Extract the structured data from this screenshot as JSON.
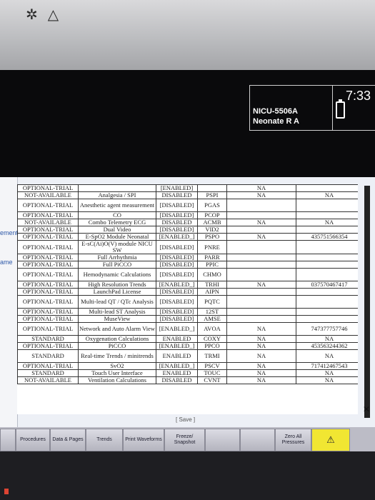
{
  "bezel": {
    "icons": [
      "sun-sparkle-icon",
      "warning-triangle-icon"
    ]
  },
  "patient": {
    "bed": "NICU-5506A",
    "name": "Neonate R A"
  },
  "status": {
    "time": "7:33",
    "battery_icon": "battery-icon"
  },
  "sidebar": {
    "labels": [
      "ement",
      "ame"
    ]
  },
  "table": {
    "rows": [
      {
        "status": "OPTIONAL-TRIAL",
        "feature": "",
        "state": "[ENABLED]",
        "code": "",
        "key": "NA",
        "lic": "",
        "type": "sh"
      },
      {
        "status": "NOT-AVAILABLE",
        "feature": "Analgesia / SPI",
        "state": "DISABLED",
        "code": "PSPI",
        "key": "NA",
        "lic": "NA",
        "type": "n"
      },
      {
        "status": "OPTIONAL-TRIAL",
        "feature": "Anesthetic agent measurement",
        "state": "[DISABLED]",
        "code": "PGAS",
        "key": "",
        "lic": "",
        "type": "t"
      },
      {
        "status": "OPTIONAL-TRIAL",
        "feature": "CO",
        "state": "[DISABLED]",
        "code": "PCOP",
        "key": "",
        "lic": "",
        "type": "n"
      },
      {
        "status": "NOT-AVAILABLE",
        "feature": "Combo Telemetry ECG",
        "state": "DISABLED",
        "code": "ACMB",
        "key": "NA",
        "lic": "NA",
        "type": "n"
      },
      {
        "status": "OPTIONAL-TRIAL",
        "feature": "Dual Video",
        "state": "[DISABLED]",
        "code": "VID2",
        "key": "",
        "lic": "",
        "type": "n"
      },
      {
        "status": "OPTIONAL-TRIAL",
        "feature": "E-SpO2 Module Neonatal",
        "state": "[ENABLED_]",
        "code": "PSPO",
        "key": "NA",
        "lic": "435751566354",
        "type": "n"
      },
      {
        "status": "OPTIONAL-TRIAL",
        "feature": "E-sC(Ai)O(V) module NICU SW",
        "state": "[DISABLED]",
        "code": "PNRE",
        "key": "",
        "lic": "",
        "type": "t"
      },
      {
        "status": "OPTIONAL-TRIAL",
        "feature": "Full Arrhythmia",
        "state": "[DISABLED]",
        "code": "PARR",
        "key": "",
        "lic": "",
        "type": "n"
      },
      {
        "status": "OPTIONAL-TRIAL",
        "feature": "Full PiCCO",
        "state": "[DISABLED]",
        "code": "PPIC",
        "key": "",
        "lic": "",
        "type": "n"
      },
      {
        "status": "OPTIONAL-TRIAL",
        "feature": "Hemodynamic Calculations",
        "state": "[DISABLED]",
        "code": "CHMO",
        "key": "",
        "lic": "",
        "type": "t"
      },
      {
        "status": "OPTIONAL-TRIAL",
        "feature": "High Resolution Trends",
        "state": "[ENABLED_]",
        "code": "TRHI",
        "key": "NA",
        "lic": "037570467417",
        "type": "n"
      },
      {
        "status": "OPTIONAL-TRIAL",
        "feature": "LaunchPad License",
        "state": "[DISABLED]",
        "code": "AIPN",
        "key": "",
        "lic": "",
        "type": "n"
      },
      {
        "status": "OPTIONAL-TRIAL",
        "feature": "Multi-lead QT / QTc Analysis",
        "state": "[DISABLED]",
        "code": "PQTC",
        "key": "",
        "lic": "",
        "type": "t"
      },
      {
        "status": "OPTIONAL-TRIAL",
        "feature": "Multi-lead ST Analysis",
        "state": "[DISABLED]",
        "code": "12ST",
        "key": "",
        "lic": "",
        "type": "n"
      },
      {
        "status": "OPTIONAL-TRIAL",
        "feature": "MuseView",
        "state": "[DISABLED]",
        "code": "AMSE",
        "key": "",
        "lic": "",
        "type": "n"
      },
      {
        "status": "OPTIONAL-TRIAL",
        "feature": "Network and Auto Alarm View",
        "state": "[ENABLED_]",
        "code": "AVOA",
        "key": "NA",
        "lic": "747377757746",
        "type": "t"
      },
      {
        "status": "STANDARD",
        "feature": "Oxygenation Calculations",
        "state": "ENABLED",
        "code": "COXY",
        "key": "NA",
        "lic": "NA",
        "type": "n"
      },
      {
        "status": "OPTIONAL-TRIAL",
        "feature": "PiCCO",
        "state": "[ENABLED_]",
        "code": "PPCO",
        "key": "NA",
        "lic": "453563244362",
        "type": "n"
      },
      {
        "status": "STANDARD",
        "feature": "Real-time Trends / minitrends",
        "state": "ENABLED",
        "code": "TRMI",
        "key": "NA",
        "lic": "NA",
        "type": "t"
      },
      {
        "status": "OPTIONAL-TRIAL",
        "feature": "SvO2",
        "state": "[ENABLED_]",
        "code": "PSCV",
        "key": "NA",
        "lic": "717412467543",
        "type": "n"
      },
      {
        "status": "STANDARD",
        "feature": "Touch User Interface",
        "state": "ENABLED",
        "code": "TOUC",
        "key": "NA",
        "lic": "NA",
        "type": "n"
      },
      {
        "status": "NOT-AVAILABLE",
        "feature": "Ventilation Calculations",
        "state": "DISABLED",
        "code": "CVNT",
        "key": "NA",
        "lic": "NA",
        "type": "n"
      }
    ]
  },
  "save_label": "[ Save ]",
  "toolbar": {
    "buttons": [
      {
        "label": "",
        "disabled": false
      },
      {
        "label": "Procedures",
        "disabled": false
      },
      {
        "label": "Data & Pages",
        "disabled": false
      },
      {
        "label": "Trends",
        "disabled": false
      },
      {
        "label": "Print Waveforms",
        "disabled": false
      },
      {
        "label": "Freeze/ Snapshot",
        "disabled": false
      },
      {
        "label": "",
        "disabled": true
      },
      {
        "label": "",
        "disabled": true
      },
      {
        "label": "Zero All Pressures",
        "disabled": false
      },
      {
        "label": "⚠",
        "disabled": false,
        "alarm": true
      }
    ]
  }
}
